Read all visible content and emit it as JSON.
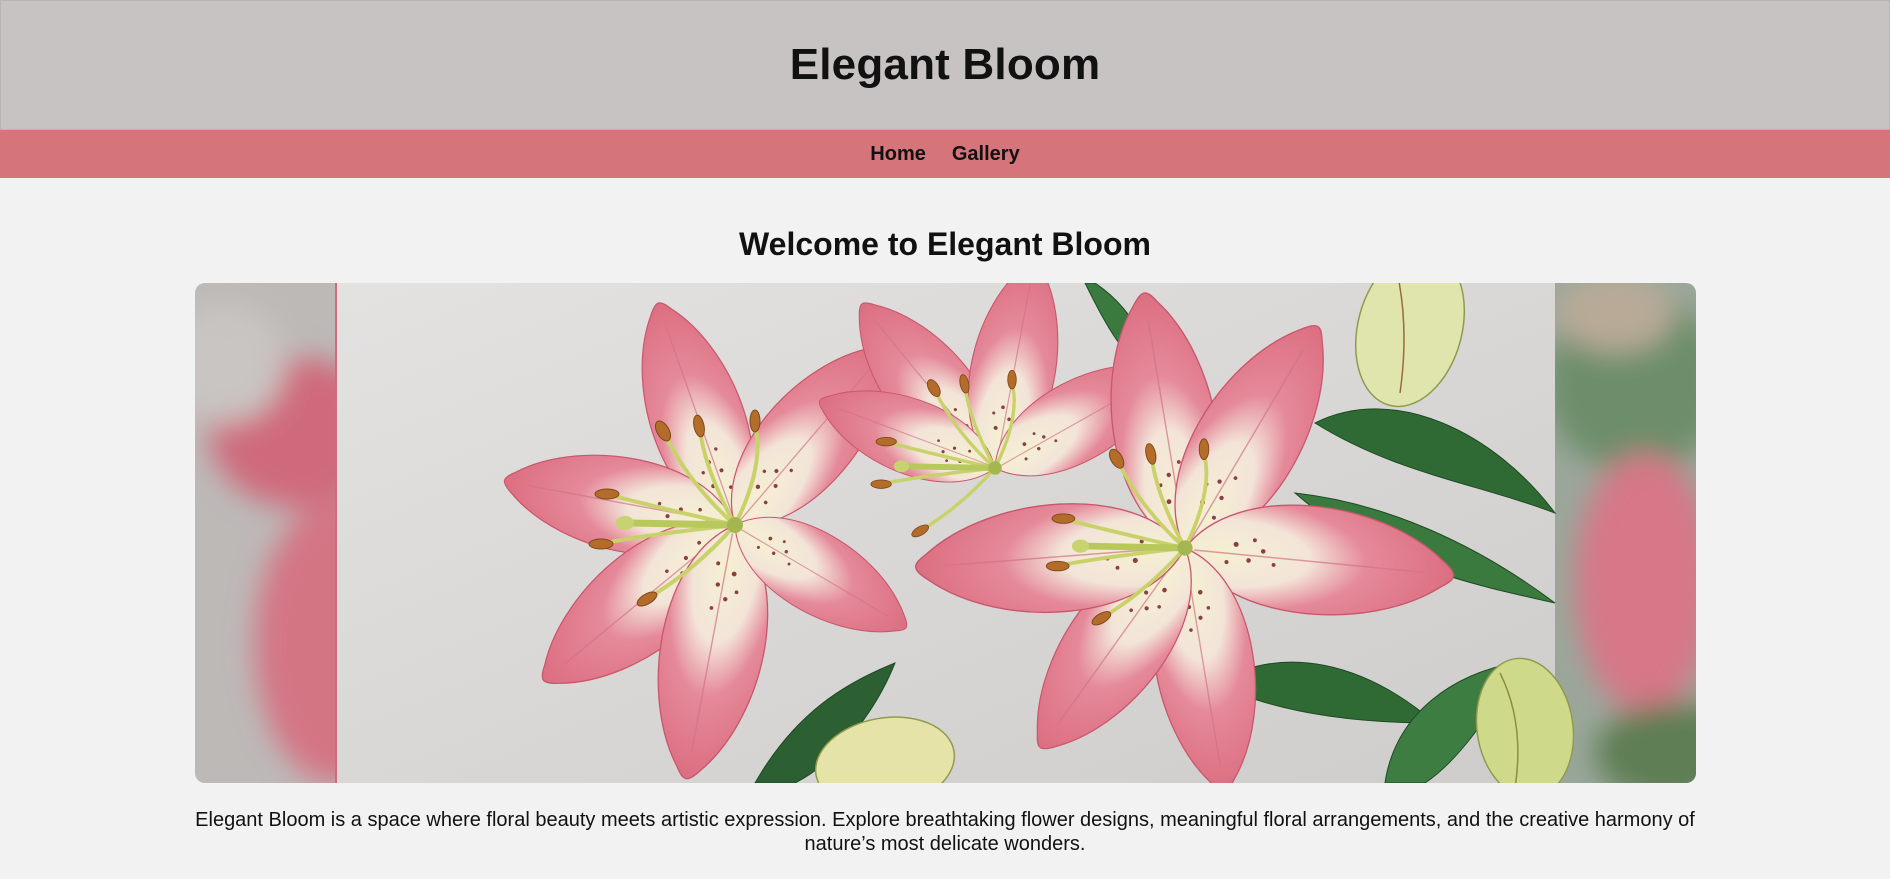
{
  "header": {
    "title": "Elegant Bloom"
  },
  "nav": {
    "items": [
      {
        "label": "Home"
      },
      {
        "label": "Gallery"
      }
    ]
  },
  "main": {
    "heading": "Welcome to Elegant Bloom",
    "hero_image": {
      "subject": "pink-and-white lily blossoms with buds and green leaves",
      "accent_color": "#e2707f"
    },
    "intro": "Elegant Bloom is a space where floral beauty meets artistic expression. Explore breathtaking flower designs, meaningful floral arrangements, and the creative harmony of nature’s most delicate wonders."
  },
  "colors": {
    "header_bg": "#c8c3c3",
    "nav_bg": "#d5747a",
    "page_bg": "#f2f2f2"
  }
}
